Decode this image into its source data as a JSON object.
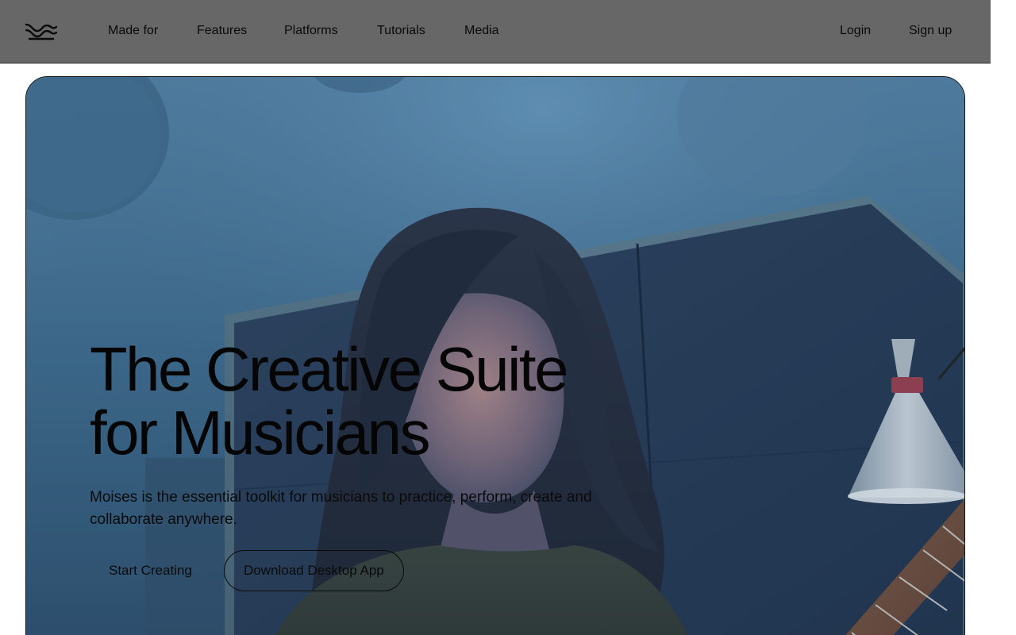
{
  "brand": {
    "logo_icon": "moises-wave-logo-icon"
  },
  "nav": {
    "items": [
      {
        "label": "Made for"
      },
      {
        "label": "Features"
      },
      {
        "label": "Platforms"
      },
      {
        "label": "Tutorials"
      },
      {
        "label": "Media"
      }
    ],
    "login_label": "Login",
    "signup_label": "Sign up"
  },
  "hero": {
    "headline_line1": "The Creative Suite",
    "headline_line2": "for Musicians",
    "subtitle": "Moises is the essential toolkit for musicians to practice, perform, create and collaborate anywhere.",
    "primary_cta": "Start Creating",
    "secondary_cta": "Download Desktop App",
    "background_image": "musician-playing-guitar-in-studio"
  },
  "colors": {
    "header_bg": "#676767",
    "text": "#0a0a0a",
    "hero_tint": "#3f6888"
  }
}
